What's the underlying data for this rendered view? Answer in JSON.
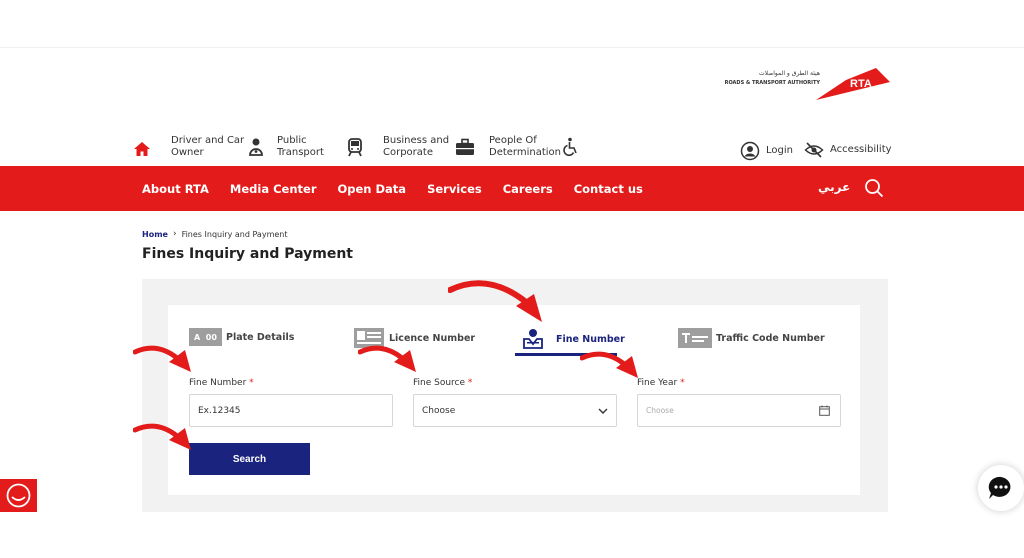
{
  "header": {
    "logo": {
      "text": "RTA",
      "arabic": "هيئة الطرق و المواصلات",
      "english": "ROADS & TRANSPORT AUTHORITY",
      "color": "#e31b1b"
    },
    "topnav": [
      {
        "line1": "Driver and Car",
        "line2": "Owner",
        "icon": "driver-icon"
      },
      {
        "line1": "Public",
        "line2": "Transport",
        "icon": "bus-icon"
      },
      {
        "line1": "Business and",
        "line2": "Corporate",
        "icon": "briefcase-icon"
      },
      {
        "line1": "People Of",
        "line2": "Determination",
        "icon": "wheelchair-icon"
      }
    ],
    "login_label": "Login",
    "accessibility_label": "Accessibility"
  },
  "redbar": {
    "color": "#e31b1b",
    "menu": [
      "About RTA",
      "Media Center",
      "Open Data",
      "Services",
      "Careers",
      "Contact us"
    ],
    "language": "عربي"
  },
  "breadcrumb": {
    "home": "Home",
    "current": "Fines Inquiry and Payment"
  },
  "page_title": "Fines Inquiry and Payment",
  "tabs": [
    {
      "label": "Plate Details",
      "icon_text": "A  00",
      "active": false
    },
    {
      "label": "Licence Number",
      "active": false
    },
    {
      "label": "Fine Number",
      "active": true
    },
    {
      "label": "Traffic Code Number",
      "active": false
    }
  ],
  "form": {
    "fine_number": {
      "label": "Fine Number",
      "placeholder": "Ex.12345"
    },
    "fine_source": {
      "label": "Fine Source",
      "value": "Choose"
    },
    "fine_year": {
      "label": "Fine Year",
      "placeholder": "Choose"
    },
    "required_mark": "*",
    "search_label": "Search"
  },
  "colors": {
    "primary_red": "#e31b1b",
    "primary_navy": "#1a237e"
  }
}
